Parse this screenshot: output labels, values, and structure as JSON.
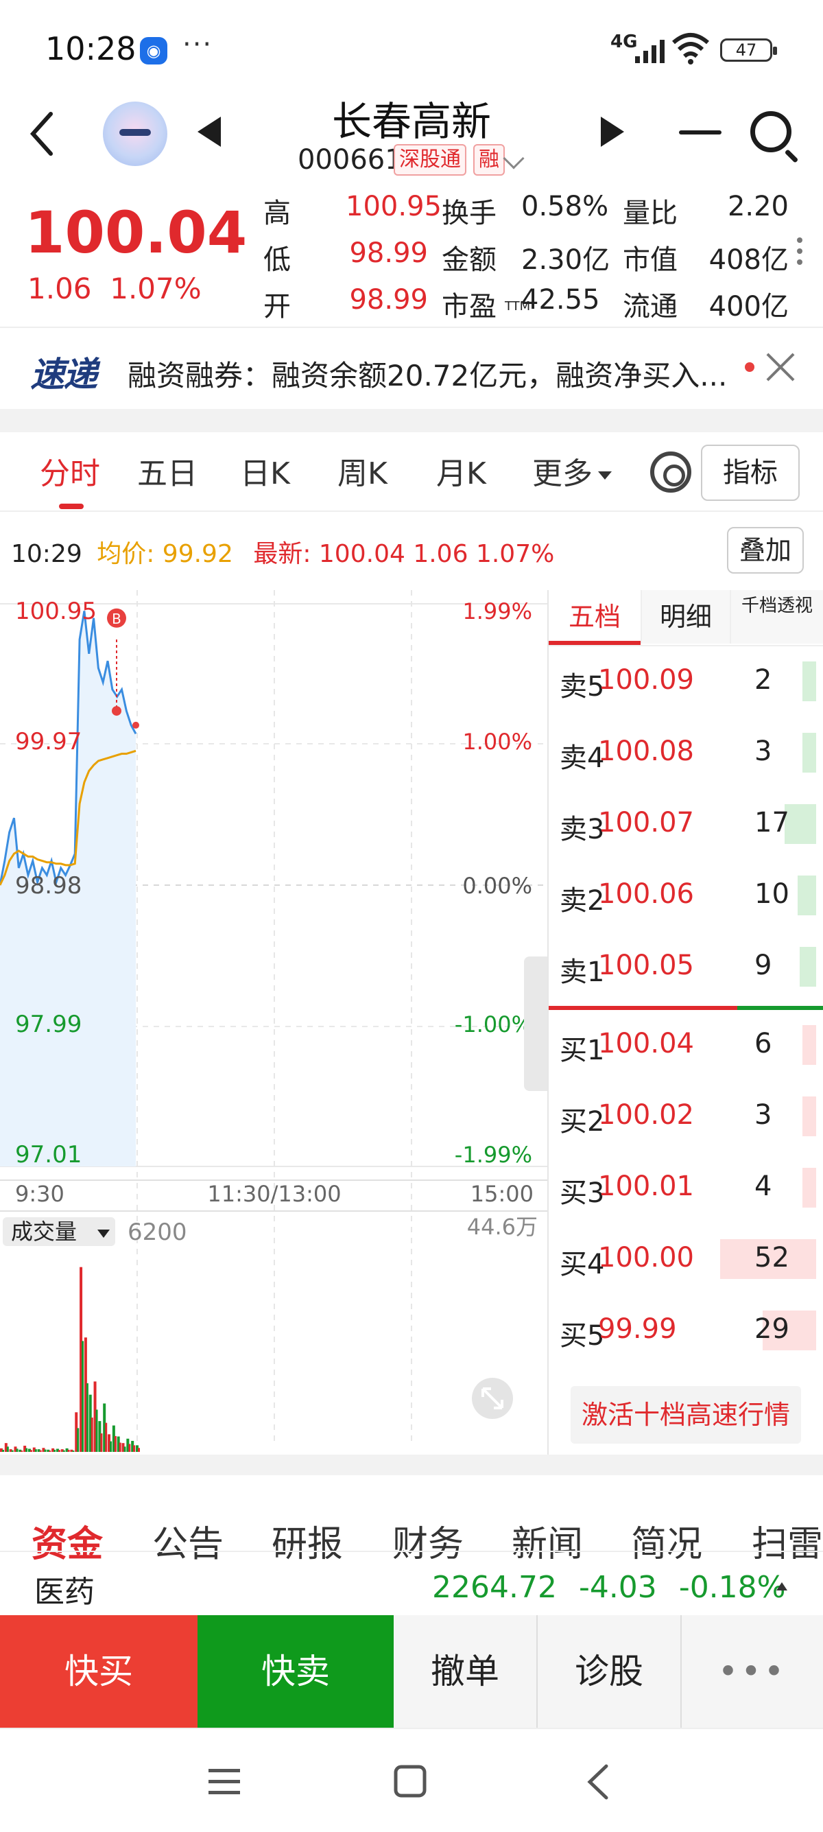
{
  "status_bar": {
    "time": "10:28",
    "dots": "···",
    "network": "4G",
    "battery": "47"
  },
  "header": {
    "title": "长春高新",
    "code": "000661",
    "tags": [
      "深股通",
      "融"
    ]
  },
  "quote": {
    "price": "100.04",
    "change": "1.06",
    "change_pct": "1.07%",
    "rows": [
      [
        {
          "label": "高",
          "value": "100.95",
          "color": "red"
        },
        {
          "label": "换手",
          "value": "0.58%"
        },
        {
          "label": "量比",
          "value": "2.20"
        }
      ],
      [
        {
          "label": "低",
          "value": "98.99",
          "color": "red"
        },
        {
          "label": "金额",
          "value": "2.30亿"
        },
        {
          "label": "市值",
          "value": "408亿"
        }
      ],
      [
        {
          "label": "开",
          "value": "98.99",
          "color": "red"
        },
        {
          "label": "市盈",
          "sub": "TTM",
          "value": "42.55"
        },
        {
          "label": "流通",
          "value": "400亿"
        }
      ]
    ]
  },
  "ticker": {
    "logo": "速递",
    "text": "融资融券：融资余额20.72亿元，融资净买入..."
  },
  "tabs": {
    "items": [
      "分时",
      "五日",
      "日K",
      "周K",
      "月K",
      "更多"
    ],
    "active": 0,
    "indicator": "指标"
  },
  "chart_info": {
    "time": "10:29",
    "avg_label": "均价:",
    "avg": "99.92",
    "latest_label": "最新:",
    "latest": "100.04",
    "chg": "1.06",
    "pct": "1.07%",
    "overlay_btn": "叠加"
  },
  "chart_data": {
    "type": "line",
    "y_left_ticks": [
      "100.95",
      "99.97",
      "98.98",
      "97.99",
      "97.01"
    ],
    "y_right_ticks": [
      "1.99%",
      "1.00%",
      "0.00%",
      "-1.00%",
      "-1.99%"
    ],
    "x_ticks": [
      "9:30",
      "11:30/13:00",
      "15:00"
    ],
    "ylim": [
      97.01,
      100.95
    ],
    "x": [
      "9:30",
      "9:31",
      "9:32",
      "9:33",
      "9:34",
      "9:35",
      "9:36",
      "9:37",
      "9:38",
      "9:39",
      "9:40",
      "9:41",
      "9:42",
      "9:43",
      "9:44",
      "9:45",
      "9:46",
      "9:47",
      "9:48",
      "9:49",
      "9:50",
      "9:51",
      "9:52",
      "9:53",
      "9:54",
      "9:55",
      "9:56",
      "9:57",
      "9:58",
      "9:59"
    ],
    "series": [
      {
        "values": [
          98.98,
          99.15,
          99.35,
          99.45,
          99.1,
          99.2,
          99.05,
          99.15,
          99.0,
          99.1,
          99.05,
          99.15,
          99.0,
          99.1,
          99.05,
          99.12,
          99.2,
          100.7,
          100.9,
          100.6,
          100.85,
          100.5,
          100.4,
          100.55,
          100.35,
          100.3,
          100.35,
          100.2,
          100.1,
          100.04
        ]
      },
      {
        "values": [
          98.98,
          99.05,
          99.15,
          99.2,
          99.22,
          99.2,
          99.18,
          99.18,
          99.16,
          99.15,
          99.14,
          99.14,
          99.13,
          99.13,
          99.12,
          99.12,
          99.13,
          99.55,
          99.7,
          99.78,
          99.82,
          99.85,
          99.86,
          99.87,
          99.88,
          99.89,
          99.9,
          99.9,
          99.91,
          99.92
        ]
      }
    ],
    "volume_label": "成交量",
    "volume_value": "6200",
    "volume_max": "44.6万",
    "volume": [
      8,
      20,
      6,
      12,
      5,
      14,
      7,
      10,
      6,
      9,
      5,
      8,
      7,
      6,
      8,
      5,
      90,
      420,
      260,
      130,
      160,
      70,
      110,
      40,
      60,
      35,
      20,
      30,
      25,
      15
    ]
  },
  "orderbook": {
    "tabs": [
      "五档",
      "明细",
      "千档透视"
    ],
    "asks": [
      {
        "label": "卖5",
        "price": "100.09",
        "vol": "2",
        "bar": 0.04
      },
      {
        "label": "卖4",
        "price": "100.08",
        "vol": "3",
        "bar": 0.06
      },
      {
        "label": "卖3",
        "price": "100.07",
        "vol": "17",
        "bar": 0.33
      },
      {
        "label": "卖2",
        "price": "100.06",
        "vol": "10",
        "bar": 0.19
      },
      {
        "label": "卖1",
        "price": "100.05",
        "vol": "9",
        "bar": 0.17
      }
    ],
    "bids": [
      {
        "label": "买1",
        "price": "100.04",
        "vol": "6",
        "bar": 0.12
      },
      {
        "label": "买2",
        "price": "100.02",
        "vol": "3",
        "bar": 0.06
      },
      {
        "label": "买3",
        "price": "100.01",
        "vol": "4",
        "bar": 0.08
      },
      {
        "label": "买4",
        "price": "100.00",
        "vol": "52",
        "bar": 1.0
      },
      {
        "label": "买5",
        "price": "99.99",
        "vol": "29",
        "bar": 0.56
      }
    ],
    "activate": "激活十档高速行情"
  },
  "bottom_tabs": [
    "资金",
    "公告",
    "研报",
    "财务",
    "新闻",
    "简况",
    "扫雷"
  ],
  "industry": {
    "name": "医药",
    "value": "2264.72",
    "chg": "-4.03",
    "pct": "-0.18%"
  },
  "actions": [
    "快买",
    "快卖",
    "撤单",
    "诊股",
    "•••"
  ],
  "colors": {
    "up": "#e0292d",
    "down": "#169a2e",
    "avg": "#e8a000",
    "line": "#3a8de0"
  }
}
